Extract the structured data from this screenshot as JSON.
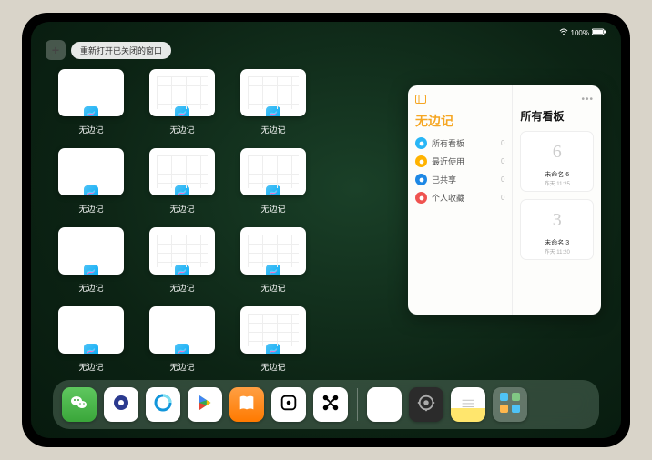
{
  "status": {
    "battery": "100%"
  },
  "top": {
    "plus": "+",
    "reopen_label": "重新打开已关闭的窗口"
  },
  "thumbs": {
    "label": "无边记",
    "rows": [
      [
        {
          "t": "blank"
        },
        {
          "t": "grid"
        },
        {
          "t": "grid"
        }
      ],
      [
        {
          "t": "blank"
        },
        {
          "t": "grid"
        },
        {
          "t": "grid"
        }
      ],
      [
        {
          "t": "blank"
        },
        {
          "t": "grid"
        },
        {
          "t": "grid"
        }
      ],
      [
        {
          "t": "blank"
        },
        {
          "t": "blank"
        },
        {
          "t": "grid"
        }
      ]
    ]
  },
  "panel": {
    "title": "无边记",
    "right_title": "所有看板",
    "categories": [
      {
        "label": "所有看板",
        "count": "0",
        "color": "#29b6f6"
      },
      {
        "label": "最近使用",
        "count": "0",
        "color": "#ffb300"
      },
      {
        "label": "已共享",
        "count": "0",
        "color": "#1e88e5"
      },
      {
        "label": "个人收藏",
        "count": "0",
        "color": "#ef5350"
      }
    ],
    "boards": [
      {
        "glyph": "6",
        "name": "未命名 6",
        "time": "昨天 11:25"
      },
      {
        "glyph": "3",
        "name": "未命名 3",
        "time": "昨天 11:20"
      }
    ]
  },
  "dock": {
    "apps": [
      {
        "name": "wechat"
      },
      {
        "name": "quark"
      },
      {
        "name": "qqbrowser"
      },
      {
        "name": "play"
      },
      {
        "name": "books"
      },
      {
        "name": "dice"
      },
      {
        "name": "nodes"
      }
    ],
    "recent": [
      {
        "name": "freeform"
      },
      {
        "name": "settings"
      },
      {
        "name": "notes"
      },
      {
        "name": "app-library"
      }
    ]
  }
}
